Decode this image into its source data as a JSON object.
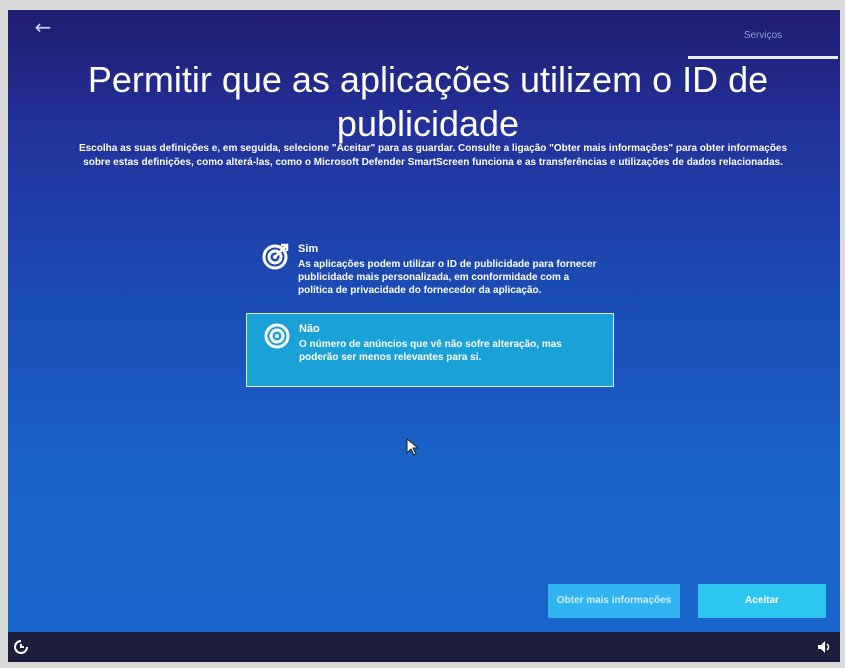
{
  "header": {
    "back_icon": "back-arrow-icon",
    "progress_label": "Serviços"
  },
  "main": {
    "title": "Permitir que as aplicações utilizem o ID de publicidade",
    "subtitle": "Escolha as suas definições e, em seguida, selecione \"Aceitar\" para as guardar. Consulte a ligação \"Obter mais informações\" para obter informações sobre estas definições, como alterá-las, como o Microsoft Defender SmartScreen funciona e as transferências e utilizações de dados relacionadas."
  },
  "options": [
    {
      "icon": "target-icon",
      "title": "Sim",
      "description": "As aplicações podem utilizar o ID de publicidade para fornecer publicidade mais personalizada, em conformidade com a política de privacidade do fornecedor da aplicação.",
      "selected": false
    },
    {
      "icon": "target-off-icon",
      "title": "Não",
      "description": "O número de anúncios que vê não sofre alteração, mas poderão ser menos relevantes para si.",
      "selected": true
    }
  ],
  "buttons": {
    "learn_more": "Obter mais informações",
    "accept": "Aceitar"
  },
  "taskbar": {
    "left_icon": "accessibility-icon",
    "right_icon": "volume-icon"
  },
  "colors": {
    "selected_option": "#1aa2d8",
    "accept_button": "#2ec6f0",
    "learn_more_button": "#32b4f0"
  }
}
